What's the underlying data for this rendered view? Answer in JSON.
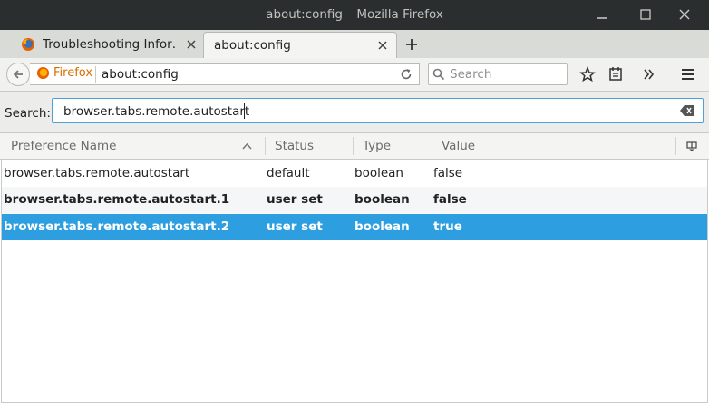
{
  "window": {
    "title": "about:config – Mozilla Firefox"
  },
  "tabs": [
    {
      "label": "Troubleshooting Infor…",
      "active": false,
      "icon": "firefox-logo-icon"
    },
    {
      "label": "about:config",
      "active": true,
      "icon": ""
    }
  ],
  "navbar": {
    "identity_label": "Firefox",
    "url": "about:config",
    "search_placeholder": "Search"
  },
  "filter": {
    "label": "Search:",
    "value": "browser.tabs.remote.autostart"
  },
  "columns": {
    "name": "Preference Name",
    "status": "Status",
    "type": "Type",
    "value": "Value"
  },
  "rows": [
    {
      "name": "browser.tabs.remote.autostart",
      "status": "default",
      "type": "boolean",
      "value": "false",
      "modified": false,
      "selected": false
    },
    {
      "name": "browser.tabs.remote.autostart.1",
      "status": "user set",
      "type": "boolean",
      "value": "false",
      "modified": true,
      "selected": false
    },
    {
      "name": "browser.tabs.remote.autostart.2",
      "status": "user set",
      "type": "boolean",
      "value": "true",
      "modified": true,
      "selected": true
    }
  ],
  "colors": {
    "titlebar": "#2b2e2f",
    "accent_selected": "#2d9ee0",
    "focus_border": "#4f9fd8",
    "identity": "#d76e00"
  }
}
